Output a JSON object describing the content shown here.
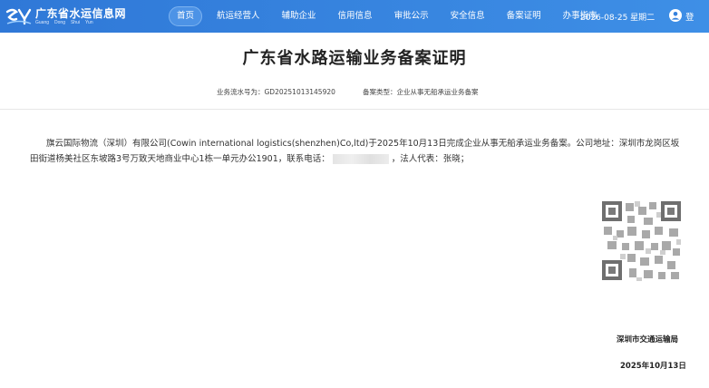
{
  "header": {
    "site_name": "广东省水运信息网",
    "site_sub": [
      "Guang",
      "Dong",
      "Shui",
      "Yun"
    ],
    "nav": [
      {
        "label": "首页",
        "active": true
      },
      {
        "label": "航运经营人",
        "active": false
      },
      {
        "label": "辅助企业",
        "active": false
      },
      {
        "label": "信用信息",
        "active": false
      },
      {
        "label": "审批公示",
        "active": false
      },
      {
        "label": "安全信息",
        "active": false
      },
      {
        "label": "备案证明",
        "active": false
      },
      {
        "label": "办事指南",
        "active": false
      }
    ],
    "date": "2026-08-25 星期二",
    "user_label": "登"
  },
  "document": {
    "title": "广东省水路运输业务备案证明",
    "serial_label": "业务流水号为：",
    "serial_value": "GD20251013145920",
    "type_label": "备案类型：",
    "type_value": "企业从事无船承运业务备案",
    "body_part1": "旗云国际物流（深圳）有限公司(Cowin international logistics(shenzhen)Co,ltd)于2025年10月13日完成企业从事无船承运业务备案。公司地址：深圳市龙岗区坂田街道杨美社区东坡路3号万致天地商业中心1栋一单元办公1901，联系电话：",
    "body_part2": "，法人代表：张晓；",
    "issuer": "深圳市交通运输局",
    "issue_date": "2025年10月13日"
  },
  "colors": {
    "nav_bg": "#3581dd",
    "text": "#333333"
  }
}
